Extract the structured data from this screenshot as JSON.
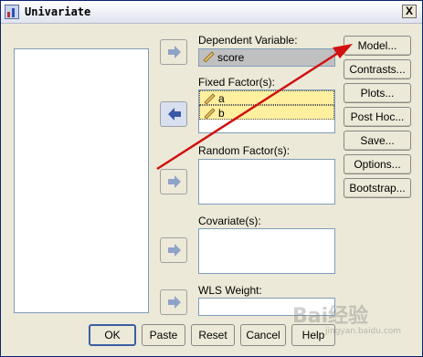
{
  "window": {
    "title": "Univariate",
    "close_symbol": "X"
  },
  "fields": {
    "dependent": {
      "label": "Dependent Variable:",
      "items": [
        "score"
      ]
    },
    "fixed": {
      "label": "Fixed Factor(s):",
      "items": [
        "a",
        "b"
      ]
    },
    "random": {
      "label": "Random Factor(s):"
    },
    "covariate": {
      "label": "Covariate(s):"
    },
    "wls": {
      "label": "WLS Weight:"
    }
  },
  "side_buttons": [
    "Model...",
    "Contrasts...",
    "Plots...",
    "Post Hoc...",
    "Save...",
    "Options...",
    "Bootstrap..."
  ],
  "bottom_buttons": [
    "OK",
    "Paste",
    "Reset",
    "Cancel",
    "Help"
  ],
  "watermark": {
    "text": "Bai经验",
    "sub": "jingyan.baidu.com"
  },
  "colors": {
    "selection": "#fff0a0",
    "annotation_arrow": "#d01010",
    "accent": "#0a246a"
  }
}
